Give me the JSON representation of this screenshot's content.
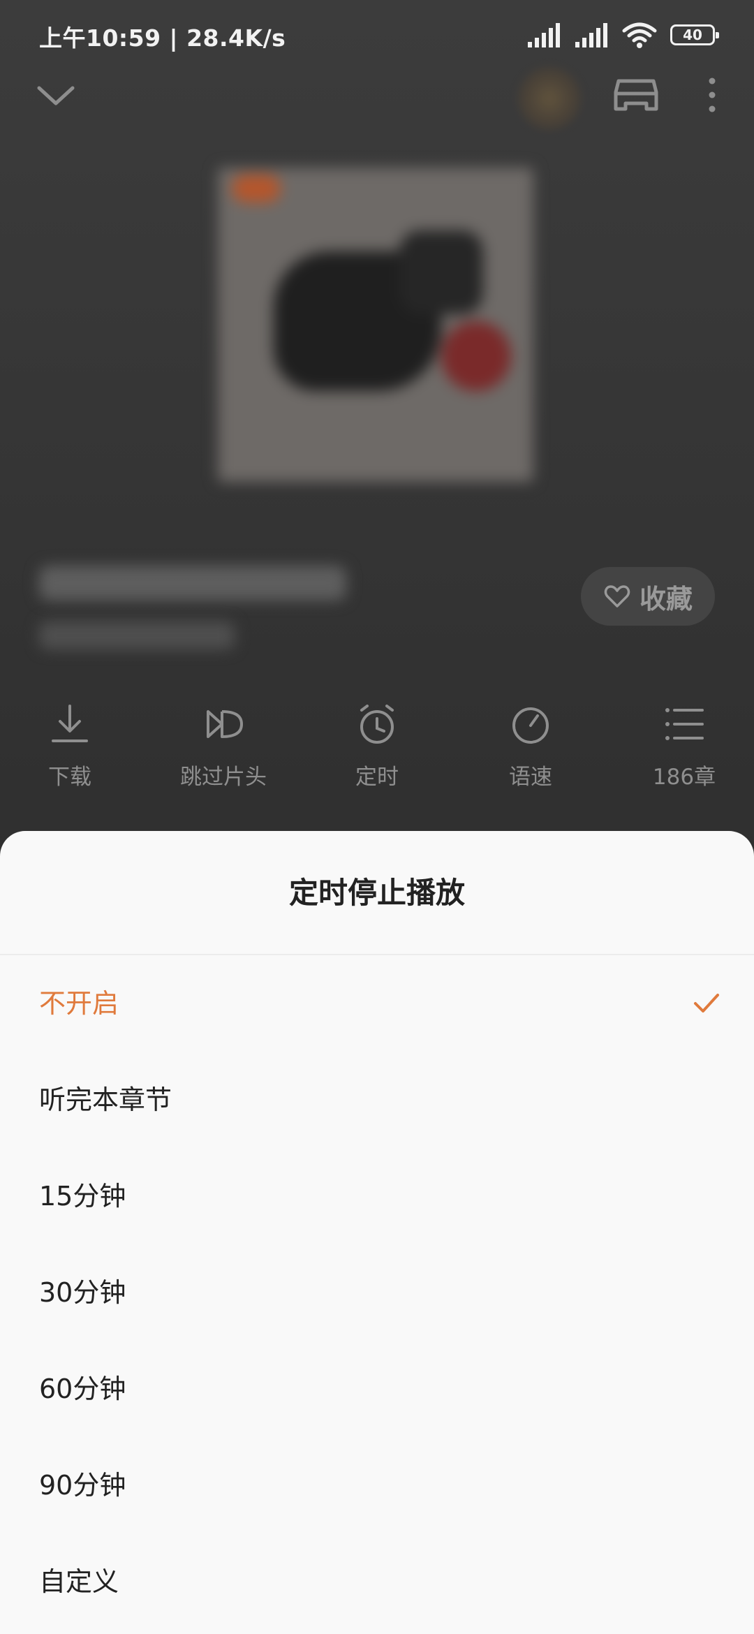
{
  "status_bar": {
    "time": "上午10:59 | 28.4K/s",
    "battery": "40"
  },
  "player": {
    "favorite_label": "收藏",
    "actions": [
      {
        "label": "下载",
        "icon": "download-icon"
      },
      {
        "label": "跳过片头",
        "icon": "skip-intro-icon"
      },
      {
        "label": "定时",
        "icon": "alarm-clock-icon"
      },
      {
        "label": "语速",
        "icon": "speed-dial-icon"
      },
      {
        "label": "186章",
        "icon": "list-icon"
      }
    ]
  },
  "sheet": {
    "title": "定时停止播放",
    "accent_color": "#e07a3c",
    "options": [
      {
        "label": "不开启",
        "selected": true
      },
      {
        "label": "听完本章节",
        "selected": false
      },
      {
        "label": "15分钟",
        "selected": false
      },
      {
        "label": "30分钟",
        "selected": false
      },
      {
        "label": "60分钟",
        "selected": false
      },
      {
        "label": "90分钟",
        "selected": false
      },
      {
        "label": "自定义",
        "selected": false
      }
    ]
  }
}
